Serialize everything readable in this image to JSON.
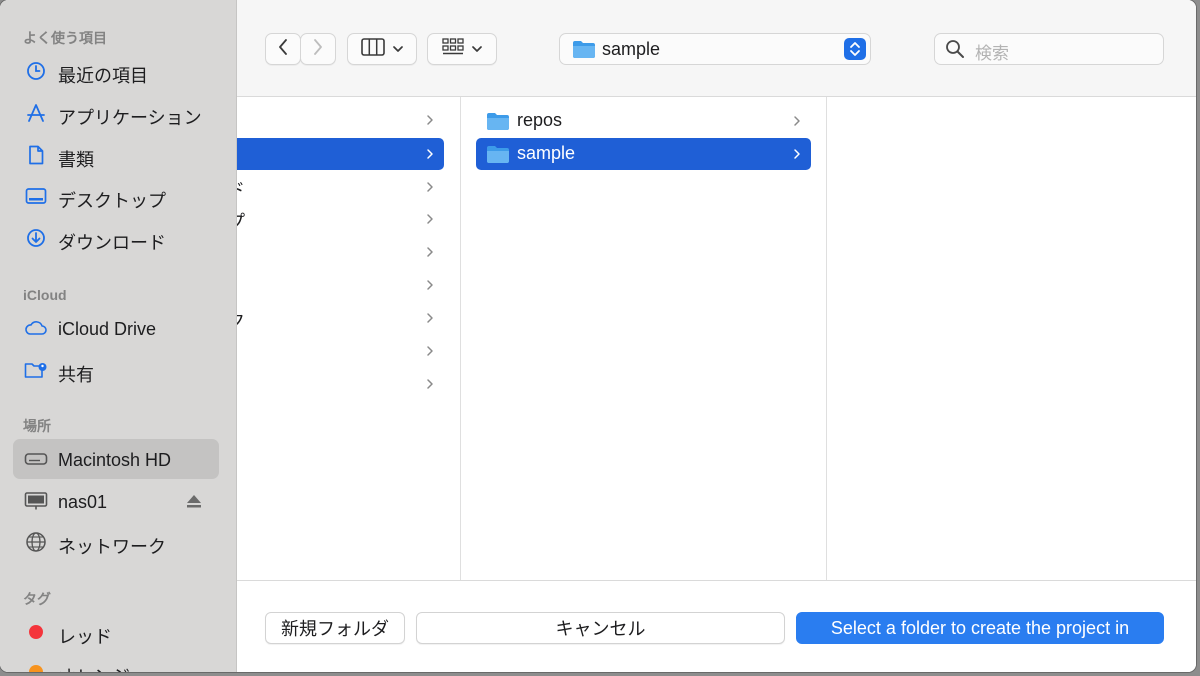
{
  "sidebar": {
    "favorites_heading": "よく使う項目",
    "favorites": [
      {
        "label": "最近の項目",
        "icon": "clock-icon"
      },
      {
        "label": "アプリケーション",
        "icon": "app-store-icon"
      },
      {
        "label": "書類",
        "icon": "document-icon"
      },
      {
        "label": "デスクトップ",
        "icon": "desktop-icon"
      },
      {
        "label": "ダウンロード",
        "icon": "download-icon"
      }
    ],
    "icloud_heading": "iCloud",
    "icloud": [
      {
        "label": "iCloud Drive",
        "icon": "cloud-icon"
      },
      {
        "label": "共有",
        "icon": "shared-folder-icon"
      }
    ],
    "locations_heading": "場所",
    "locations": [
      {
        "label": "Macintosh HD",
        "icon": "drive-icon",
        "selected": true
      },
      {
        "label": "nas01",
        "icon": "monitor-icon",
        "eject": true
      },
      {
        "label": "ネットワーク",
        "icon": "globe-icon"
      }
    ],
    "tags_heading": "タグ",
    "tags": [
      {
        "label": "レッド",
        "color": "#f4343b"
      },
      {
        "label": "オレンジ",
        "color": "#f7931e"
      }
    ]
  },
  "toolbar": {
    "path_label": "sample",
    "search_placeholder": "検索"
  },
  "browser": {
    "column1_fragments": [
      "ード",
      "ップ",
      "ー",
      "ーク"
    ],
    "column2_items": [
      {
        "label": "repos",
        "selected": false
      },
      {
        "label": "sample",
        "selected": true
      }
    ]
  },
  "buttons": {
    "new_folder": "新規フォルダ",
    "cancel": "キャンセル",
    "select": "Select a folder to create the project in"
  },
  "colors": {
    "accent": "#2a7df0",
    "selection": "#1f5fd6",
    "sidebar_icon": "#1f6fe7"
  }
}
